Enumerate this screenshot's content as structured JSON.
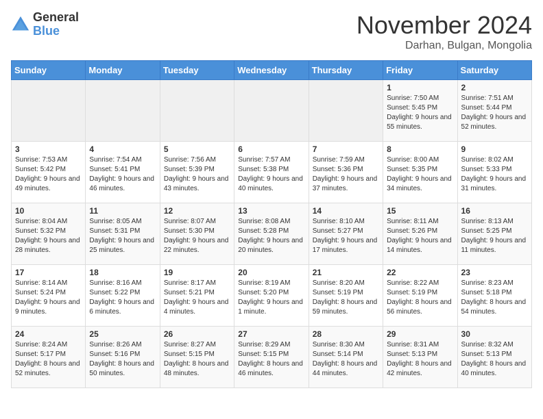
{
  "logo": {
    "general": "General",
    "blue": "Blue"
  },
  "title": {
    "month_year": "November 2024",
    "location": "Darhan, Bulgan, Mongolia"
  },
  "weekdays": [
    "Sunday",
    "Monday",
    "Tuesday",
    "Wednesday",
    "Thursday",
    "Friday",
    "Saturday"
  ],
  "weeks": [
    [
      {
        "day": "",
        "sunrise": "",
        "sunset": "",
        "daylight": ""
      },
      {
        "day": "",
        "sunrise": "",
        "sunset": "",
        "daylight": ""
      },
      {
        "day": "",
        "sunrise": "",
        "sunset": "",
        "daylight": ""
      },
      {
        "day": "",
        "sunrise": "",
        "sunset": "",
        "daylight": ""
      },
      {
        "day": "",
        "sunrise": "",
        "sunset": "",
        "daylight": ""
      },
      {
        "day": "1",
        "sunrise": "Sunrise: 7:50 AM",
        "sunset": "Sunset: 5:45 PM",
        "daylight": "Daylight: 9 hours and 55 minutes."
      },
      {
        "day": "2",
        "sunrise": "Sunrise: 7:51 AM",
        "sunset": "Sunset: 5:44 PM",
        "daylight": "Daylight: 9 hours and 52 minutes."
      }
    ],
    [
      {
        "day": "3",
        "sunrise": "Sunrise: 7:53 AM",
        "sunset": "Sunset: 5:42 PM",
        "daylight": "Daylight: 9 hours and 49 minutes."
      },
      {
        "day": "4",
        "sunrise": "Sunrise: 7:54 AM",
        "sunset": "Sunset: 5:41 PM",
        "daylight": "Daylight: 9 hours and 46 minutes."
      },
      {
        "day": "5",
        "sunrise": "Sunrise: 7:56 AM",
        "sunset": "Sunset: 5:39 PM",
        "daylight": "Daylight: 9 hours and 43 minutes."
      },
      {
        "day": "6",
        "sunrise": "Sunrise: 7:57 AM",
        "sunset": "Sunset: 5:38 PM",
        "daylight": "Daylight: 9 hours and 40 minutes."
      },
      {
        "day": "7",
        "sunrise": "Sunrise: 7:59 AM",
        "sunset": "Sunset: 5:36 PM",
        "daylight": "Daylight: 9 hours and 37 minutes."
      },
      {
        "day": "8",
        "sunrise": "Sunrise: 8:00 AM",
        "sunset": "Sunset: 5:35 PM",
        "daylight": "Daylight: 9 hours and 34 minutes."
      },
      {
        "day": "9",
        "sunrise": "Sunrise: 8:02 AM",
        "sunset": "Sunset: 5:33 PM",
        "daylight": "Daylight: 9 hours and 31 minutes."
      }
    ],
    [
      {
        "day": "10",
        "sunrise": "Sunrise: 8:04 AM",
        "sunset": "Sunset: 5:32 PM",
        "daylight": "Daylight: 9 hours and 28 minutes."
      },
      {
        "day": "11",
        "sunrise": "Sunrise: 8:05 AM",
        "sunset": "Sunset: 5:31 PM",
        "daylight": "Daylight: 9 hours and 25 minutes."
      },
      {
        "day": "12",
        "sunrise": "Sunrise: 8:07 AM",
        "sunset": "Sunset: 5:30 PM",
        "daylight": "Daylight: 9 hours and 22 minutes."
      },
      {
        "day": "13",
        "sunrise": "Sunrise: 8:08 AM",
        "sunset": "Sunset: 5:28 PM",
        "daylight": "Daylight: 9 hours and 20 minutes."
      },
      {
        "day": "14",
        "sunrise": "Sunrise: 8:10 AM",
        "sunset": "Sunset: 5:27 PM",
        "daylight": "Daylight: 9 hours and 17 minutes."
      },
      {
        "day": "15",
        "sunrise": "Sunrise: 8:11 AM",
        "sunset": "Sunset: 5:26 PM",
        "daylight": "Daylight: 9 hours and 14 minutes."
      },
      {
        "day": "16",
        "sunrise": "Sunrise: 8:13 AM",
        "sunset": "Sunset: 5:25 PM",
        "daylight": "Daylight: 9 hours and 11 minutes."
      }
    ],
    [
      {
        "day": "17",
        "sunrise": "Sunrise: 8:14 AM",
        "sunset": "Sunset: 5:24 PM",
        "daylight": "Daylight: 9 hours and 9 minutes."
      },
      {
        "day": "18",
        "sunrise": "Sunrise: 8:16 AM",
        "sunset": "Sunset: 5:22 PM",
        "daylight": "Daylight: 9 hours and 6 minutes."
      },
      {
        "day": "19",
        "sunrise": "Sunrise: 8:17 AM",
        "sunset": "Sunset: 5:21 PM",
        "daylight": "Daylight: 9 hours and 4 minutes."
      },
      {
        "day": "20",
        "sunrise": "Sunrise: 8:19 AM",
        "sunset": "Sunset: 5:20 PM",
        "daylight": "Daylight: 9 hours and 1 minute."
      },
      {
        "day": "21",
        "sunrise": "Sunrise: 8:20 AM",
        "sunset": "Sunset: 5:19 PM",
        "daylight": "Daylight: 8 hours and 59 minutes."
      },
      {
        "day": "22",
        "sunrise": "Sunrise: 8:22 AM",
        "sunset": "Sunset: 5:19 PM",
        "daylight": "Daylight: 8 hours and 56 minutes."
      },
      {
        "day": "23",
        "sunrise": "Sunrise: 8:23 AM",
        "sunset": "Sunset: 5:18 PM",
        "daylight": "Daylight: 8 hours and 54 minutes."
      }
    ],
    [
      {
        "day": "24",
        "sunrise": "Sunrise: 8:24 AM",
        "sunset": "Sunset: 5:17 PM",
        "daylight": "Daylight: 8 hours and 52 minutes."
      },
      {
        "day": "25",
        "sunrise": "Sunrise: 8:26 AM",
        "sunset": "Sunset: 5:16 PM",
        "daylight": "Daylight: 8 hours and 50 minutes."
      },
      {
        "day": "26",
        "sunrise": "Sunrise: 8:27 AM",
        "sunset": "Sunset: 5:15 PM",
        "daylight": "Daylight: 8 hours and 48 minutes."
      },
      {
        "day": "27",
        "sunrise": "Sunrise: 8:29 AM",
        "sunset": "Sunset: 5:15 PM",
        "daylight": "Daylight: 8 hours and 46 minutes."
      },
      {
        "day": "28",
        "sunrise": "Sunrise: 8:30 AM",
        "sunset": "Sunset: 5:14 PM",
        "daylight": "Daylight: 8 hours and 44 minutes."
      },
      {
        "day": "29",
        "sunrise": "Sunrise: 8:31 AM",
        "sunset": "Sunset: 5:13 PM",
        "daylight": "Daylight: 8 hours and 42 minutes."
      },
      {
        "day": "30",
        "sunrise": "Sunrise: 8:32 AM",
        "sunset": "Sunset: 5:13 PM",
        "daylight": "Daylight: 8 hours and 40 minutes."
      }
    ]
  ]
}
